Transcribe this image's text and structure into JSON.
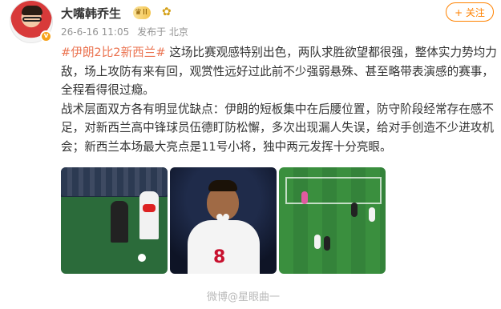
{
  "post": {
    "username": "大嘴韩乔生",
    "level_badge": "II",
    "verified_badge": "v",
    "time": "26-6-16 11:05",
    "source": "发布于 北京",
    "follow_label": "+ 关注",
    "hashtag": "#伊朗2比2新西兰#",
    "paragraph1": " 这场比赛观感特别出色，两队求胜欲望都很强，整体实力势均力敌，场上攻防有来有回，观赏性远好过此前不少强弱悬殊、甚至略带表演感的赛事，全程看得很过瘾。",
    "paragraph2": "战术层面双方各有明显优缺点：伊朗的短板集中在后腰位置，防守阶段经常存在感不足，对新西兰高中锋球员伍德盯防松懈，多次出现漏人失误，给对手创造不少进攻机会；新西兰本场最大亮点是11号小将，独中两元发挥十分亮眼。"
  },
  "images": {
    "thumb2_jersey_number": "8"
  },
  "watermark": "微博@星眼曲一",
  "icons": {
    "avatar": "avatar",
    "extra_badge": "medal-icon"
  },
  "colors": {
    "accent": "#ff8200",
    "hashtag": "#eb7350",
    "meta": "#939393"
  }
}
